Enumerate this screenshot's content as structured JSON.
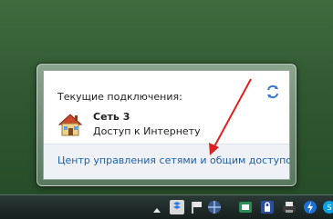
{
  "popup": {
    "header": "Текущие подключения:",
    "connection": {
      "name": "Сеть  3",
      "status": "Доступ к Интернету"
    },
    "footer_link": "Центр управления сетями и общим доступо"
  },
  "icons": {
    "refresh": "refresh-icon",
    "network": "home-network-icon"
  },
  "colors": {
    "link": "#1f5fa8",
    "arrow": "#e21f1f",
    "desktop": "#2f5730"
  },
  "tray": {
    "items": [
      "show-hidden-icons-arrow",
      "dropbox-icon",
      "flag-icon",
      "network-icon",
      "onenote-icon",
      "lock-icon",
      "printer-icon",
      "flash-icon",
      "skype-icon"
    ]
  }
}
